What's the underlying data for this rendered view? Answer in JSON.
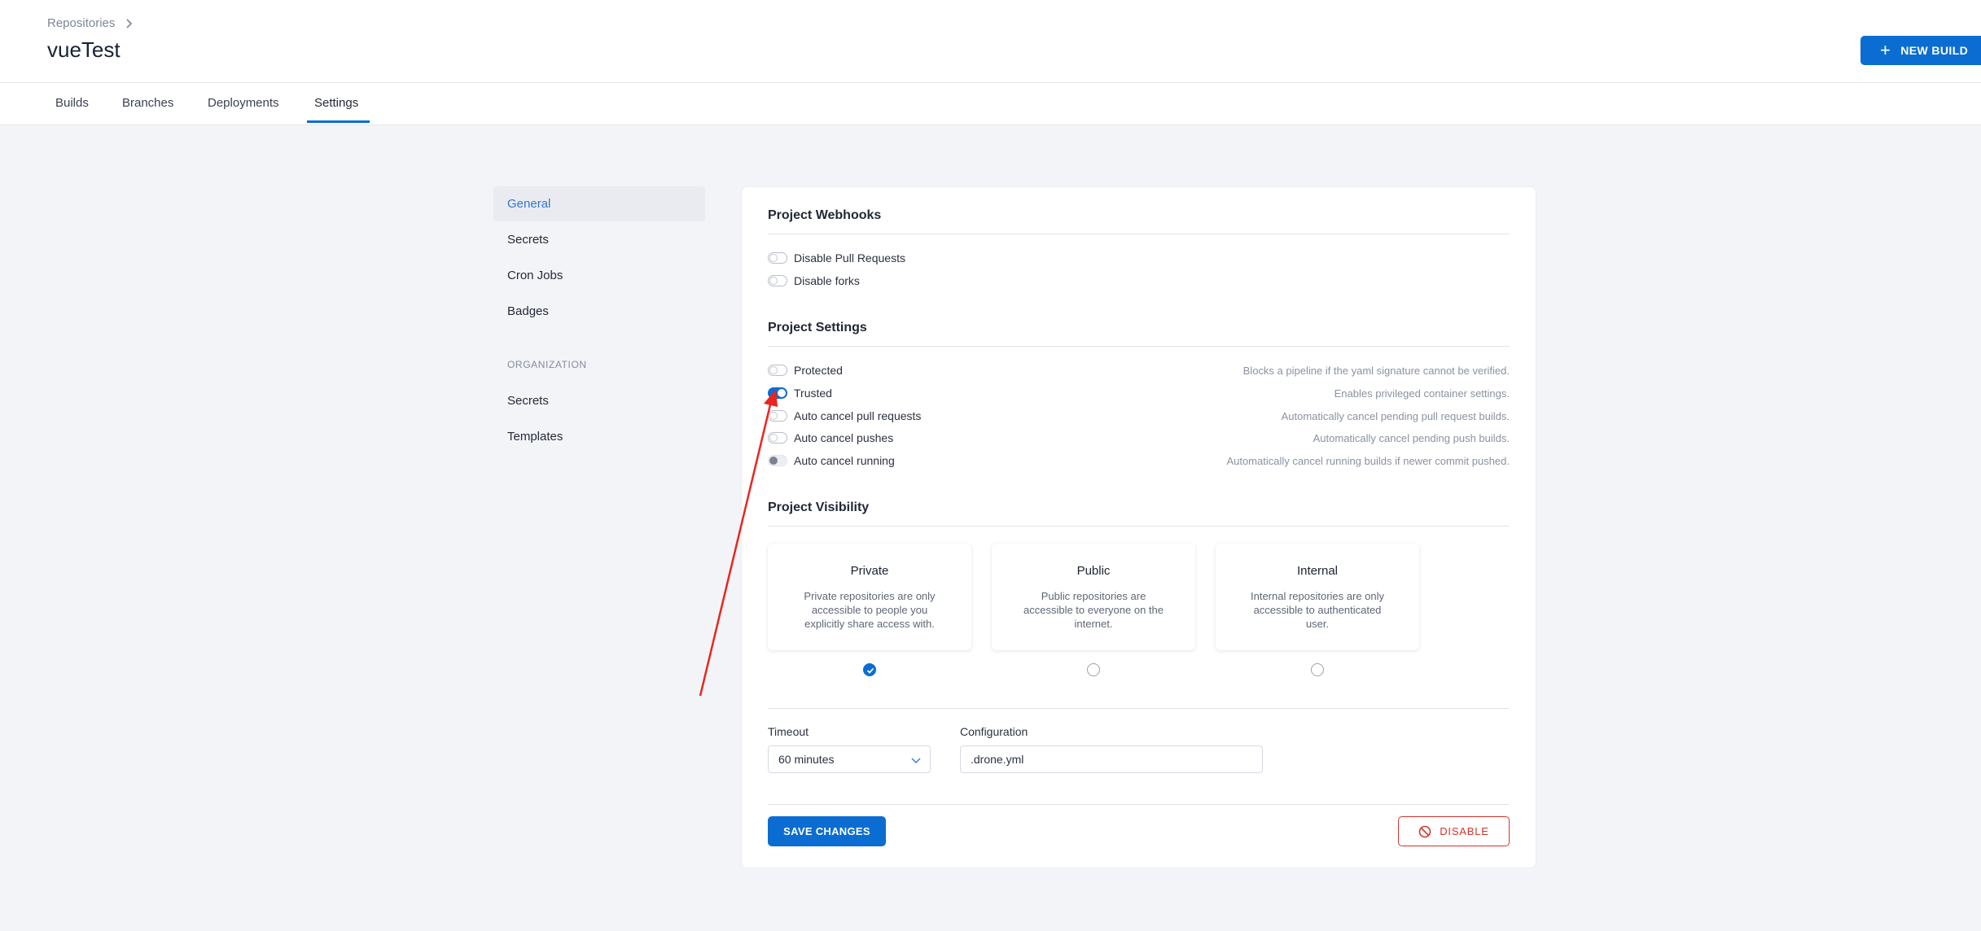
{
  "header": {
    "breadcrumb": "Repositories",
    "repo_name": "vueTest",
    "new_build_label": "NEW BUILD"
  },
  "tabs": [
    {
      "label": "Builds",
      "active": false
    },
    {
      "label": "Branches",
      "active": false
    },
    {
      "label": "Deployments",
      "active": false
    },
    {
      "label": "Settings",
      "active": true
    }
  ],
  "sidebar": {
    "items": [
      {
        "label": "General",
        "active": true
      },
      {
        "label": "Secrets"
      },
      {
        "label": "Cron Jobs"
      },
      {
        "label": "Badges"
      }
    ],
    "org_heading": "ORGANIZATION",
    "org_items": [
      {
        "label": "Secrets"
      },
      {
        "label": "Templates"
      }
    ]
  },
  "webhooks": {
    "title": "Project Webhooks",
    "toggles": [
      {
        "label": "Disable Pull Requests",
        "on": false
      },
      {
        "label": "Disable forks",
        "on": false
      }
    ]
  },
  "project_settings": {
    "title": "Project Settings",
    "toggles": [
      {
        "label": "Protected",
        "desc": "Blocks a pipeline if the yaml signature cannot be verified.",
        "on": false
      },
      {
        "label": "Trusted",
        "desc": "Enables privileged container settings.",
        "on": true
      },
      {
        "label": "Auto cancel pull requests",
        "desc": "Automatically cancel pending pull request builds.",
        "on": false
      },
      {
        "label": "Auto cancel pushes",
        "desc": "Automatically cancel pending push builds.",
        "on": false
      },
      {
        "label": "Auto cancel running",
        "desc": "Automatically cancel running builds if newer commit pushed.",
        "on": false,
        "disabled": true
      }
    ]
  },
  "visibility": {
    "title": "Project Visibility",
    "options": [
      {
        "title": "Private",
        "desc": "Private repositories are only accessible to people you explicitly share access with.",
        "selected": true
      },
      {
        "title": "Public",
        "desc": "Public repositories are accessible to everyone on the internet.",
        "selected": false
      },
      {
        "title": "Internal",
        "desc": "Internal repositories are only accessible to authenticated user.",
        "selected": false
      }
    ]
  },
  "form": {
    "timeout_label": "Timeout",
    "timeout_value": "60 minutes",
    "config_label": "Configuration",
    "config_value": ".drone.yml"
  },
  "actions": {
    "save_label": "SAVE CHANGES",
    "disable_label": "DISABLE"
  },
  "colors": {
    "accent": "#0b6dd1",
    "danger": "#d4342c",
    "annotation_arrow": "#e8261f"
  }
}
